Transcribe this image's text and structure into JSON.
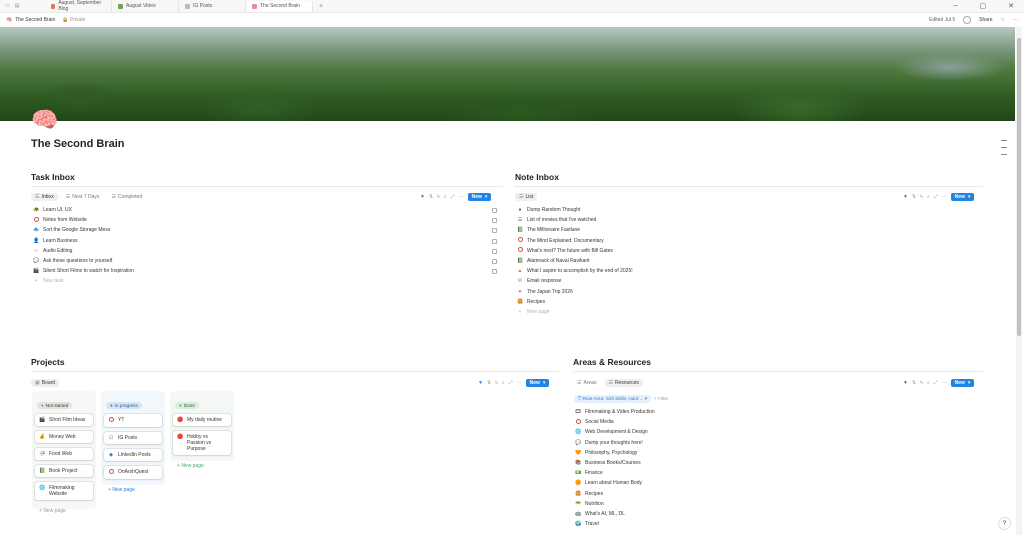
{
  "tabs": [
    {
      "label": "August, September Blog",
      "color": "#e07a5f"
    },
    {
      "label": "August Video",
      "color": "#6aa84f"
    },
    {
      "label": "IG Posts",
      "color": "#bbbbbb"
    },
    {
      "label": "The Second Brain",
      "color": "#e58ea3",
      "active": true
    }
  ],
  "topbar": {
    "breadcrumb": "The Second Brain",
    "privacy": "Private",
    "edited": "Edited Jul 5",
    "share": "Share"
  },
  "page": {
    "icon": "🧠",
    "title": "The Second Brain"
  },
  "task_inbox": {
    "title": "Task Inbox",
    "views": [
      "Inbox",
      "Next 7 Days",
      "Completed"
    ],
    "new_label": "New",
    "items": [
      {
        "icon": "🐢",
        "label": "Learn UI, UX"
      },
      {
        "icon": "ring",
        "label": "Notes from Website"
      },
      {
        "icon": "🐟",
        "label": "Sort the Google Storage Mess"
      },
      {
        "icon": "👤",
        "label": "Learn Business"
      },
      {
        "icon": "‹›",
        "label": "Audio Editing"
      },
      {
        "icon": "💬",
        "label": "Ask these questions to yourself"
      },
      {
        "icon": "🎬",
        "label": "Silent Short Films to watch for Inspiration"
      }
    ],
    "new_row": "New task"
  },
  "note_inbox": {
    "title": "Note Inbox",
    "views": [
      "List"
    ],
    "new_label": "New",
    "items": [
      {
        "icon": "●",
        "label": "Dump Random Thought"
      },
      {
        "icon": "☰",
        "label": "List of movies that I've watched"
      },
      {
        "icon": "📗",
        "label": "The Millionaire Fastlane"
      },
      {
        "icon": "ring",
        "label": "The Mind Explained: Documentary"
      },
      {
        "icon": "ring",
        "label": "What's next? The future with Bill Gates"
      },
      {
        "icon": "📗",
        "label": "Alamnack of Naval Ravikant"
      },
      {
        "icon": "▲",
        "label": "What I aspire to accomplish by the end of 2025!"
      },
      {
        "icon": "✉",
        "label": "Email response"
      },
      {
        "icon": "✦",
        "label": "The Japan Trip 2026"
      },
      {
        "icon": "🍔",
        "label": "Recipes"
      }
    ],
    "new_row": "New page"
  },
  "projects": {
    "title": "Projects",
    "views": [
      "Board"
    ],
    "new_label": "New",
    "columns": [
      {
        "name": "Not started",
        "dot": "#91918e",
        "bg": "#f7f7f5",
        "chip": "#e3e2e0",
        "cards": [
          {
            "icon": "🎬",
            "label": "Short Film Ideas"
          },
          {
            "icon": "💰",
            "label": "Money Web"
          },
          {
            "icon": "🍜",
            "label": "Food Web"
          },
          {
            "icon": "📗",
            "label": "Book Project"
          },
          {
            "icon": "🌐",
            "label": "Filmmaking Website"
          }
        ],
        "new_row": "New page"
      },
      {
        "name": "In progress",
        "dot": "#2383e2",
        "bg": "#f2f7fc",
        "chip": "#d3e5f7",
        "cards": [
          {
            "icon": "ring",
            "label": "YT"
          },
          {
            "icon": "⊡",
            "label": "IG Posts"
          },
          {
            "icon": "◆",
            "label": "LinkedIn Posts"
          },
          {
            "icon": "ring",
            "label": "OnArshQuest"
          }
        ],
        "new_row": "New page"
      },
      {
        "name": "Done",
        "dot": "#4dab6f",
        "bg": "#f3f8f4",
        "chip": "#dbeddb",
        "cards": [
          {
            "icon": "🔴",
            "label": "My daily routine"
          },
          {
            "icon": "🔴",
            "label": "Hobby vs Passion vs Purpose"
          }
        ],
        "new_row": "New page"
      }
    ]
  },
  "areas": {
    "title": "Areas & Resources",
    "views": [
      "Areas",
      "Resources"
    ],
    "filter_chip": "Root Area: Soft Skills, Hard ...",
    "filter_add": "Filter",
    "new_label": "New",
    "items": [
      {
        "icon": "🎞",
        "label": "Filmmaking & Video Production"
      },
      {
        "icon": "ring",
        "label": "Social Media"
      },
      {
        "icon": "🌐",
        "label": "Web Development & Design"
      },
      {
        "icon": "💬",
        "label": "Dump your thoughts here!"
      },
      {
        "icon": "🧡",
        "label": "Philosophy, Psychology"
      },
      {
        "icon": "📚",
        "label": "Business Books/Courses"
      },
      {
        "icon": "💵",
        "label": "Finance"
      },
      {
        "icon": "🟠",
        "label": "Learn about Human Body"
      },
      {
        "icon": "🍔",
        "label": "Recipes"
      },
      {
        "icon": "🥗",
        "label": "Nutrition"
      },
      {
        "icon": "🤖",
        "label": "What's AI, ML, DL"
      },
      {
        "icon": "🌍",
        "label": "Travel"
      }
    ]
  }
}
